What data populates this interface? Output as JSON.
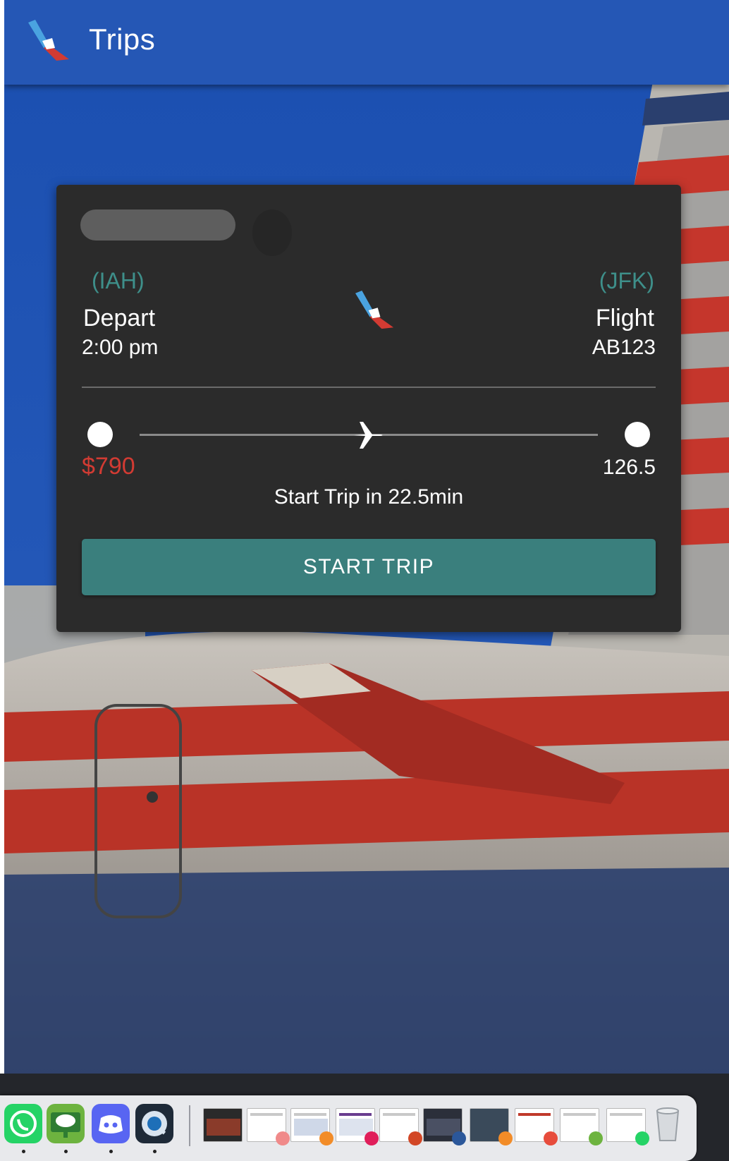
{
  "app": {
    "title": "Trips"
  },
  "trip_card": {
    "origin_code": "(IAH)",
    "destination_code": "(JFK)",
    "depart_label": "Depart",
    "depart_time": "2:00 pm",
    "flight_label": "Flight",
    "flight_number": "AB123",
    "price": "$790",
    "end_value": "126.5",
    "countdown_text": "Start Trip in 22.5min",
    "start_button_label": "START TRIP",
    "progress": 0.5
  },
  "colors": {
    "accent_teal": "#3a7f7d",
    "code_teal": "#3e8f8a",
    "price_red": "#d23b33",
    "topbar_blue": "#2557b5",
    "card_bg": "#2b2b2b"
  },
  "dock": {
    "apps": [
      {
        "name": "whatsapp-icon",
        "color": "#25d366"
      },
      {
        "name": "screen-share-icon",
        "color": "#4caf50"
      },
      {
        "name": "discord-icon",
        "color": "#5865f2"
      },
      {
        "name": "quicktime-icon",
        "color": "#1f3c5a"
      }
    ],
    "windows": [
      "window-thumbnail-1",
      "window-thumbnail-2",
      "window-thumbnail-3",
      "window-thumbnail-4",
      "window-thumbnail-5",
      "window-thumbnail-6",
      "window-thumbnail-7",
      "window-thumbnail-8",
      "window-thumbnail-9",
      "window-thumbnail-10",
      "window-thumbnail-11"
    ],
    "trash": "trash-icon"
  }
}
